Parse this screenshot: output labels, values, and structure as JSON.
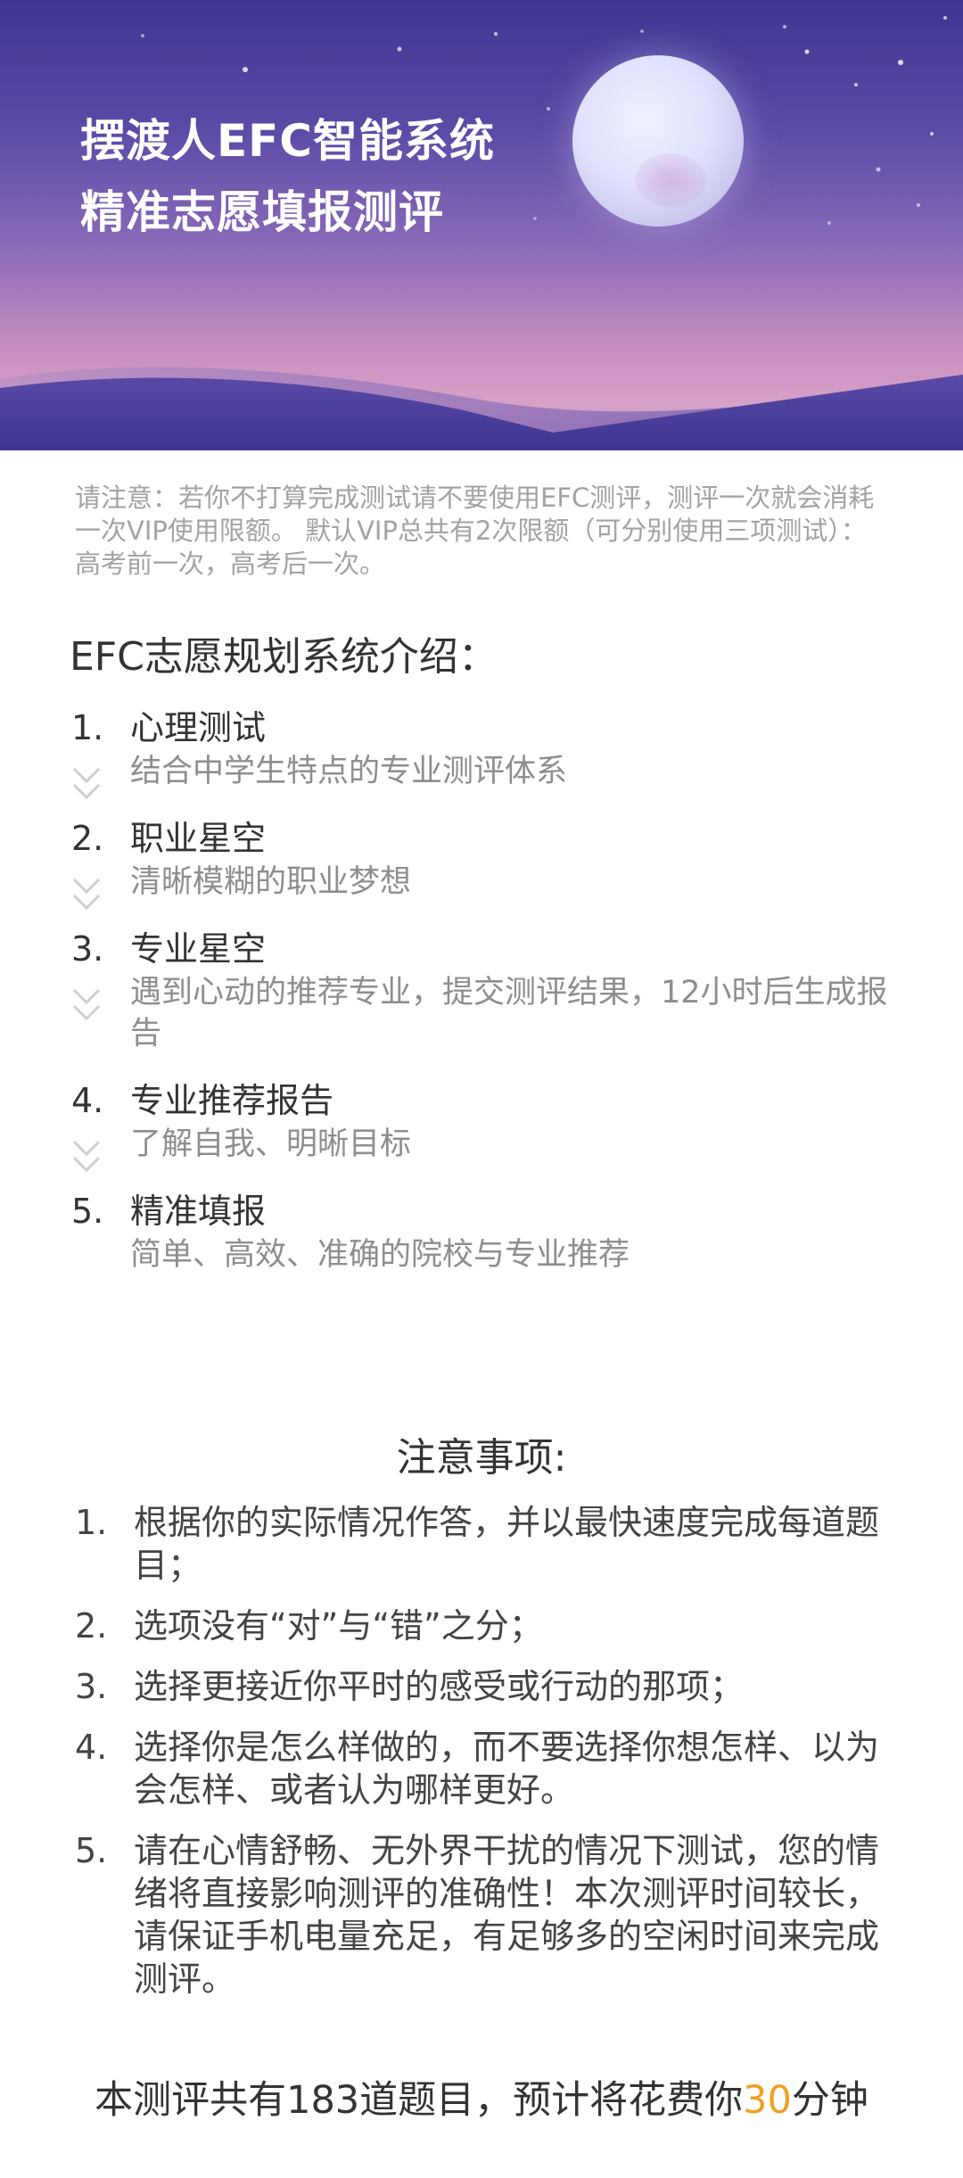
{
  "header": {
    "title_line1": "摆渡人EFC智能系统",
    "title_line2": "精准志愿填报测评"
  },
  "notice": "请注意：若你不打算完成测试请不要使用EFC测评，测评一次就会消耗一次VIP使用限额。 默认VIP总共有2次限额（可分别使用三项测试）：高考前一次，高考后一次。",
  "intro": {
    "title": "EFC志愿规划系统介绍：",
    "items": [
      {
        "num": "1.",
        "title": "心理测试",
        "desc": "结合中学生特点的专业测评体系"
      },
      {
        "num": "2.",
        "title": "职业星空",
        "desc": "清晰模糊的职业梦想"
      },
      {
        "num": "3.",
        "title": "专业星空",
        "desc": "遇到心动的推荐专业，提交测评结果，12小时后生成报告"
      },
      {
        "num": "4.",
        "title": "专业推荐报告",
        "desc": "了解自我、明晰目标"
      },
      {
        "num": "5.",
        "title": "精准填报",
        "desc": "简单、高效、准确的院校与专业推荐"
      }
    ]
  },
  "notes": {
    "title": "注意事项:",
    "items": [
      {
        "num": "1.",
        "text": "根据你的实际情况作答，并以最快速度完成每道题目；"
      },
      {
        "num": "2.",
        "text": "选项没有“对”与“错”之分；"
      },
      {
        "num": "3.",
        "text": "选择更接近你平时的感受或行动的那项；"
      },
      {
        "num": "4.",
        "text": "选择你是怎么样做的，而不要选择你想怎样、以为会怎样、或者认为哪样更好。"
      },
      {
        "num": "5.",
        "text": "请在心情舒畅、无外界干扰的情况下测试，您的情绪将直接影响测评的准确性！本次测评时间较长，请保证手机电量充足，有足够多的空闲时间来完成测评。"
      }
    ]
  },
  "footer": {
    "prefix": "本测评共有183道题目，预计将花费你",
    "minutes": "30",
    "suffix": "分钟"
  },
  "icons": {
    "chevron": "double-chevron-down-icon",
    "moon": "moon-illustration"
  },
  "colors": {
    "highlight": "#f0a020",
    "hero_top": "#3f3691"
  }
}
